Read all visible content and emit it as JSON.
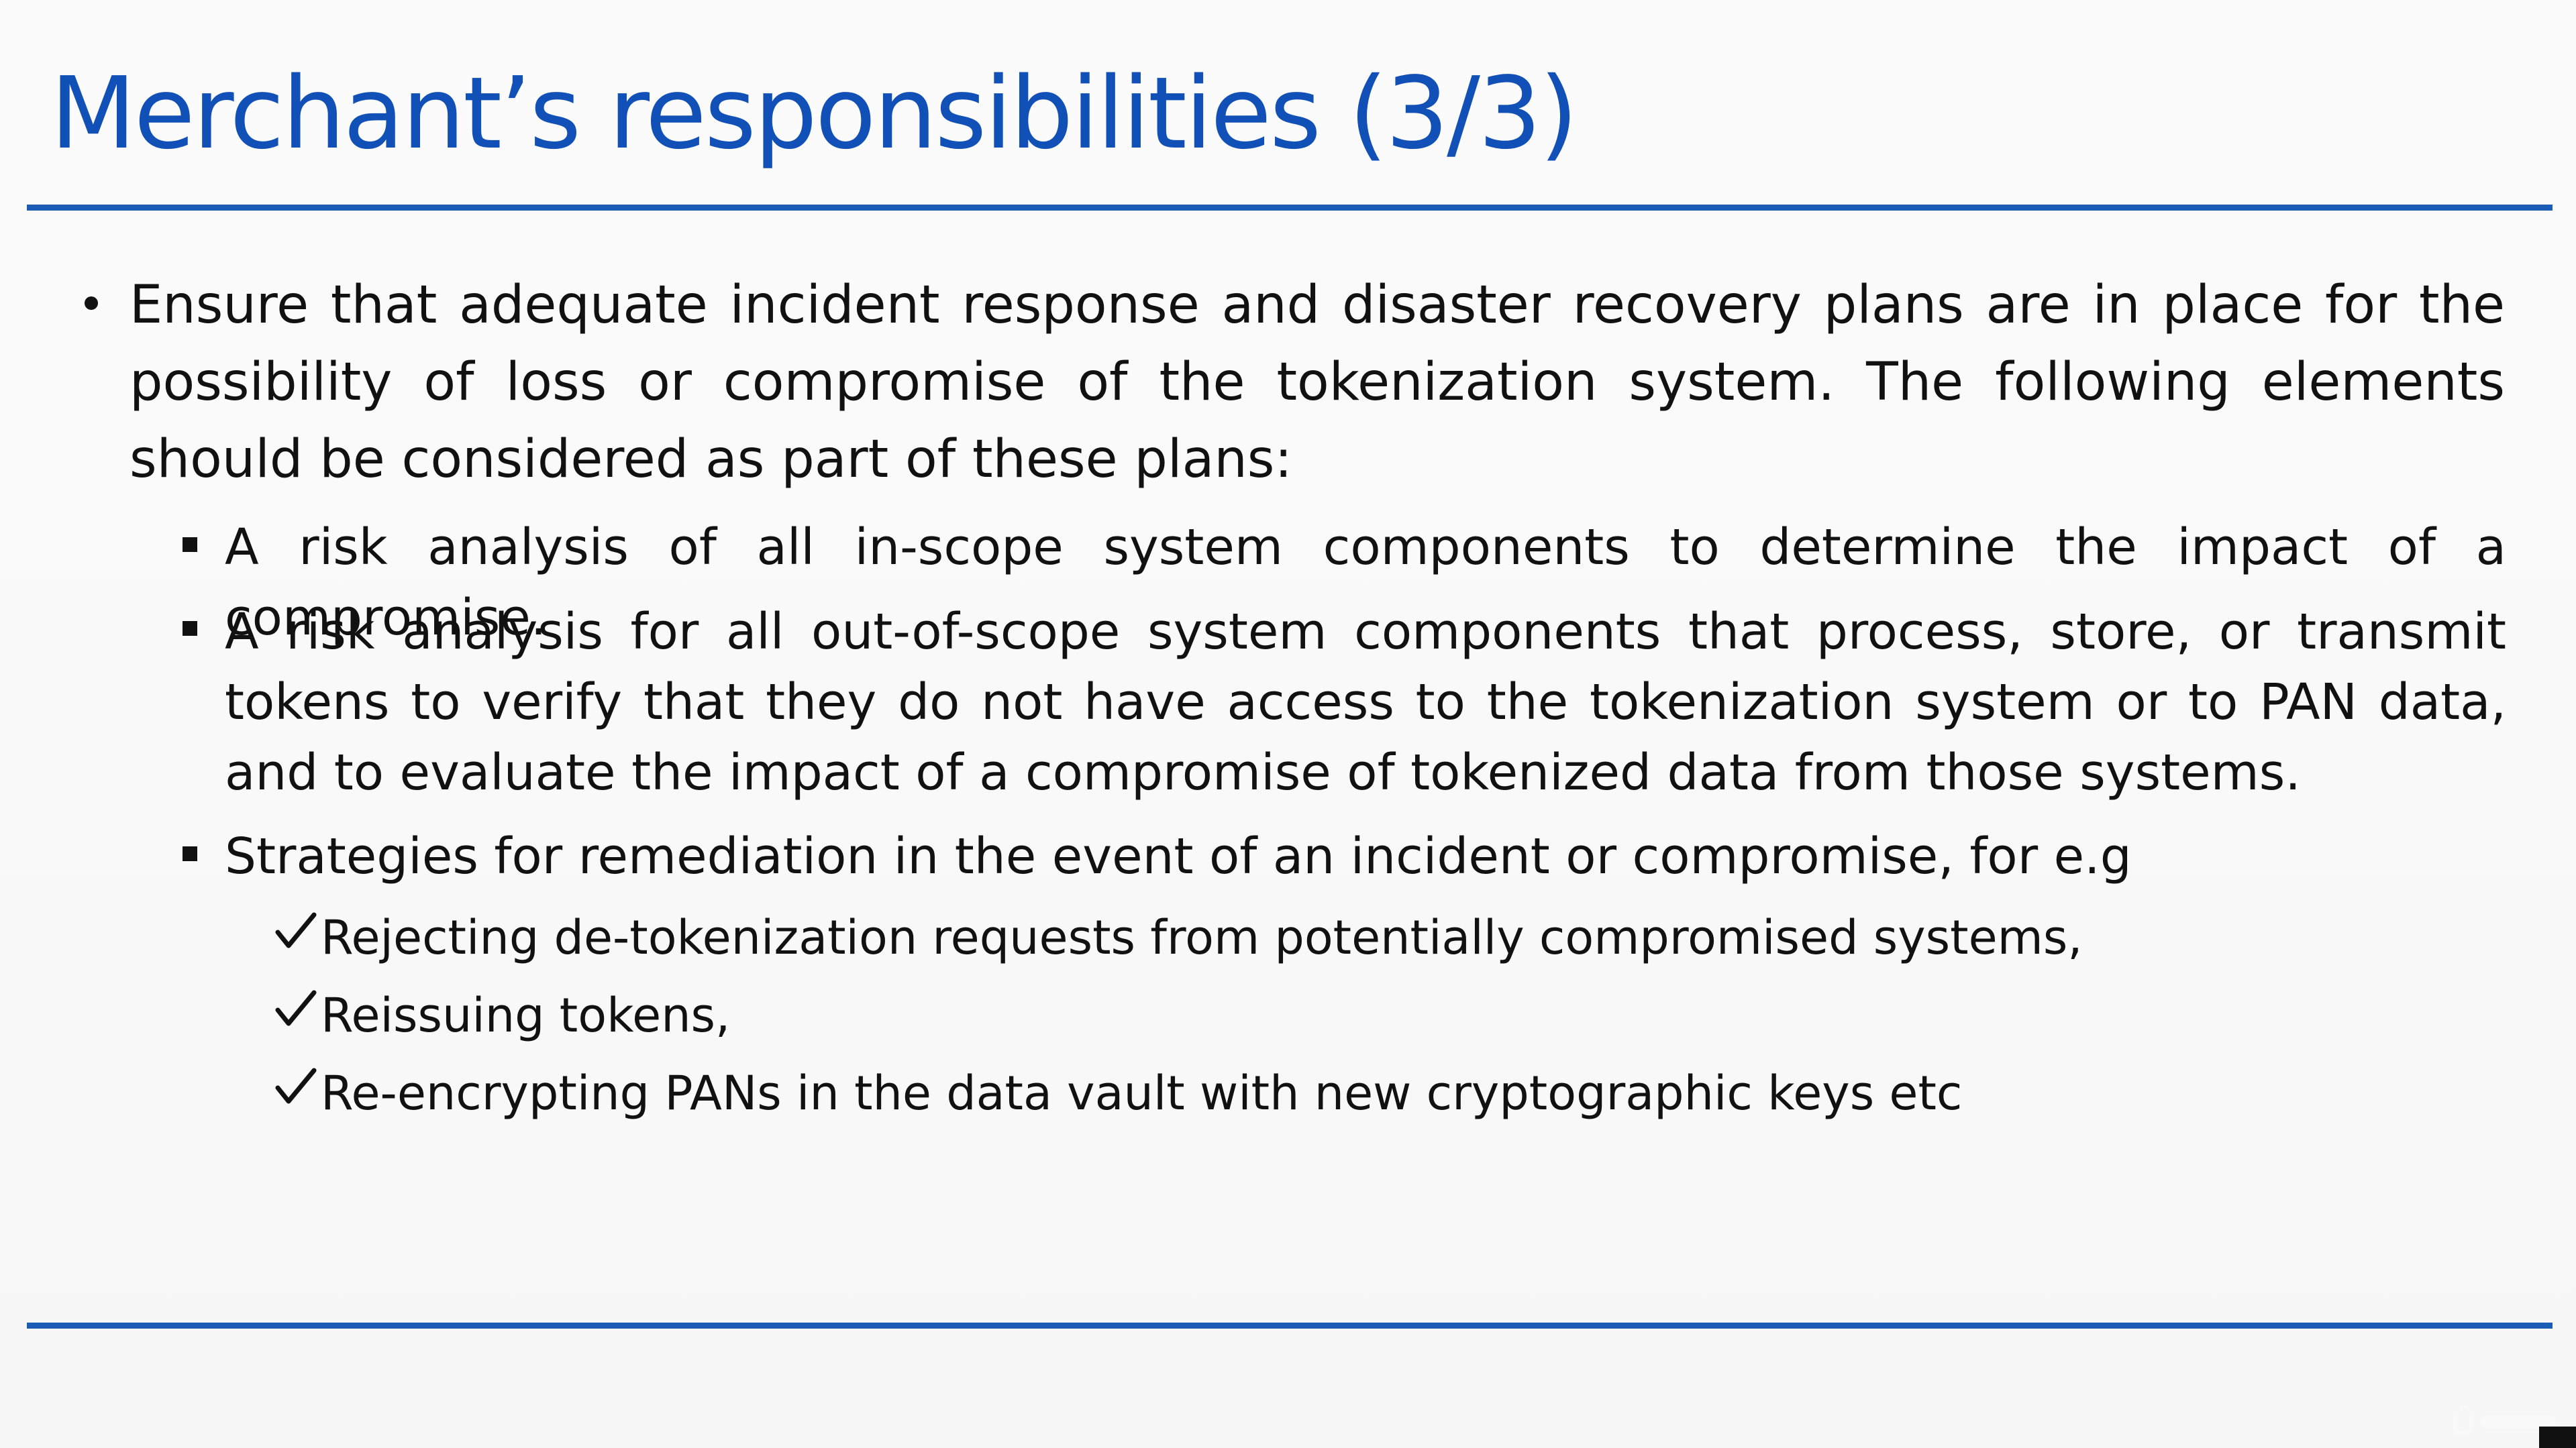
{
  "slide": {
    "title": "Merchant’s responsibilities (3/3)",
    "main_bullet": "Ensure that adequate incident response and disaster recovery plans are in place for the possibility of loss or compromise of the tokenization system. The following elements should be considered as part of these plans:",
    "sub_bullets": [
      "A risk analysis of all in-scope system components to determine the impact of a compromise.",
      "A risk analysis for all out-of-scope system components that process, store, or transmit tokens to verify that they do not have access to the tokenization system or to PAN data, and to evaluate the impact of a compromise of tokenized data from those systems.",
      "Strategies for remediation in the event of an incident or compromise, for e.g"
    ],
    "check_items": [
      "Rejecting de-tokenization requests from potentially compromised systems,",
      "Reissuing tokens,",
      "Re-encrypting PANs in the data vault with new cryptographic keys etc"
    ]
  },
  "colors": {
    "title": "#1150b6",
    "rule": "#1b5db6",
    "text": "#111111"
  },
  "icons": {
    "level1_bullet": "round-bullet-icon",
    "level2_bullet": "square-bullet-icon",
    "level3_bullet": "checkmark-icon",
    "watermark": "udemy-logo-icon"
  }
}
